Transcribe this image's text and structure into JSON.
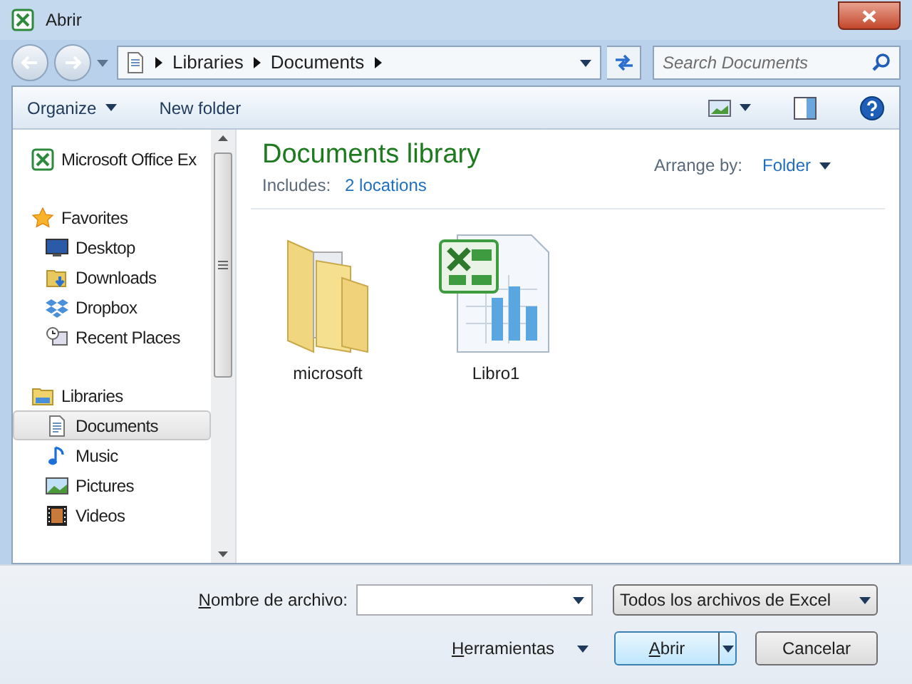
{
  "window": {
    "title": "Abrir"
  },
  "address": {
    "crumbs": [
      "Libraries",
      "Documents"
    ]
  },
  "search": {
    "placeholder": "Search Documents"
  },
  "toolbar": {
    "buttons": [
      {
        "label": "Organize",
        "kind": "menu"
      },
      {
        "label": "New folder",
        "kind": "plain"
      }
    ]
  },
  "sidebar": {
    "items": [
      {
        "label": "Microsoft Office Ex",
        "kind": "excel",
        "selected": false
      },
      {
        "label": "Favorites",
        "kind": "star",
        "selected": false,
        "children": [
          {
            "label": "Desktop",
            "kind": "desktop",
            "selected": false
          },
          {
            "label": "Downloads",
            "kind": "downloads",
            "selected": false
          },
          {
            "label": "Dropbox",
            "kind": "dropbox",
            "selected": false
          },
          {
            "label": "Recent Places",
            "kind": "recent",
            "selected": false
          }
        ]
      },
      {
        "label": "Libraries",
        "kind": "libraries",
        "selected": false,
        "children": [
          {
            "label": "Documents",
            "kind": "document",
            "selected": true
          },
          {
            "label": "Music",
            "kind": "music",
            "selected": false
          },
          {
            "label": "Pictures",
            "kind": "pictures",
            "selected": false
          },
          {
            "label": "Videos",
            "kind": "videos",
            "selected": false
          }
        ]
      }
    ]
  },
  "library": {
    "title": "Documents library",
    "includes_label": "Includes:",
    "includes_link": "2 locations",
    "arrange_label": "Arrange by:",
    "arrange_value": "Folder"
  },
  "files": [
    {
      "name": "microsoft",
      "kind": "folder"
    },
    {
      "name": "Libro1",
      "kind": "excel"
    }
  ],
  "footer": {
    "filename_label": "Nombre de archivo:",
    "filename_underline_first": true,
    "filter": "Todos los archivos de Excel",
    "tools": "Herramientas",
    "tools_underline_first": true,
    "open": "Abrir",
    "open_underline_first": true,
    "cancel": "Cancelar"
  }
}
